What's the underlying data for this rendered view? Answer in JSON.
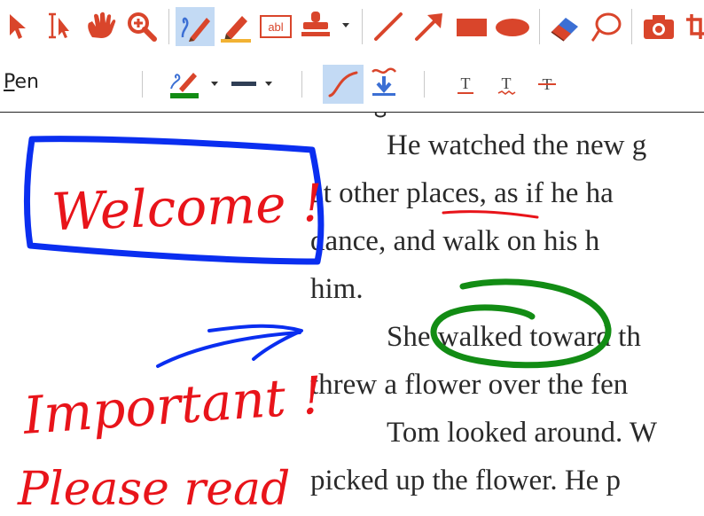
{
  "toolbar": {
    "tools": [
      {
        "name": "select-arrow-icon"
      },
      {
        "name": "text-select-icon"
      },
      {
        "name": "hand-pan-icon"
      },
      {
        "name": "zoom-icon"
      },
      {
        "name": "pen-icon",
        "active": true
      },
      {
        "name": "highlighter-icon"
      },
      {
        "name": "text-field-icon",
        "label": "abl"
      },
      {
        "name": "stamp-icon"
      },
      {
        "name": "line-icon"
      },
      {
        "name": "arrow-icon"
      },
      {
        "name": "rectangle-icon"
      },
      {
        "name": "ellipse-icon"
      },
      {
        "name": "eraser-icon"
      },
      {
        "name": "lasso-icon"
      },
      {
        "name": "camera-icon"
      }
    ],
    "mode_label_first": "P",
    "mode_label_rest": "en",
    "text_style_glyph": "T"
  },
  "document": {
    "lines": [
      "He watched the new g",
      "at other places, as if he ha",
      "dance, and walk on his h",
      "him.",
      "She walked toward th",
      "threw a flower over the fen",
      "Tom looked around. W",
      "picked up the flower. He p"
    ]
  },
  "ink": {
    "welcome_text": "Welcome !",
    "important_text": "Important !",
    "please_text": "Please read",
    "colors": {
      "red": "#e8141a",
      "blue": "#0a2ef0",
      "green": "#128c14",
      "icon": "#d9452b"
    }
  }
}
